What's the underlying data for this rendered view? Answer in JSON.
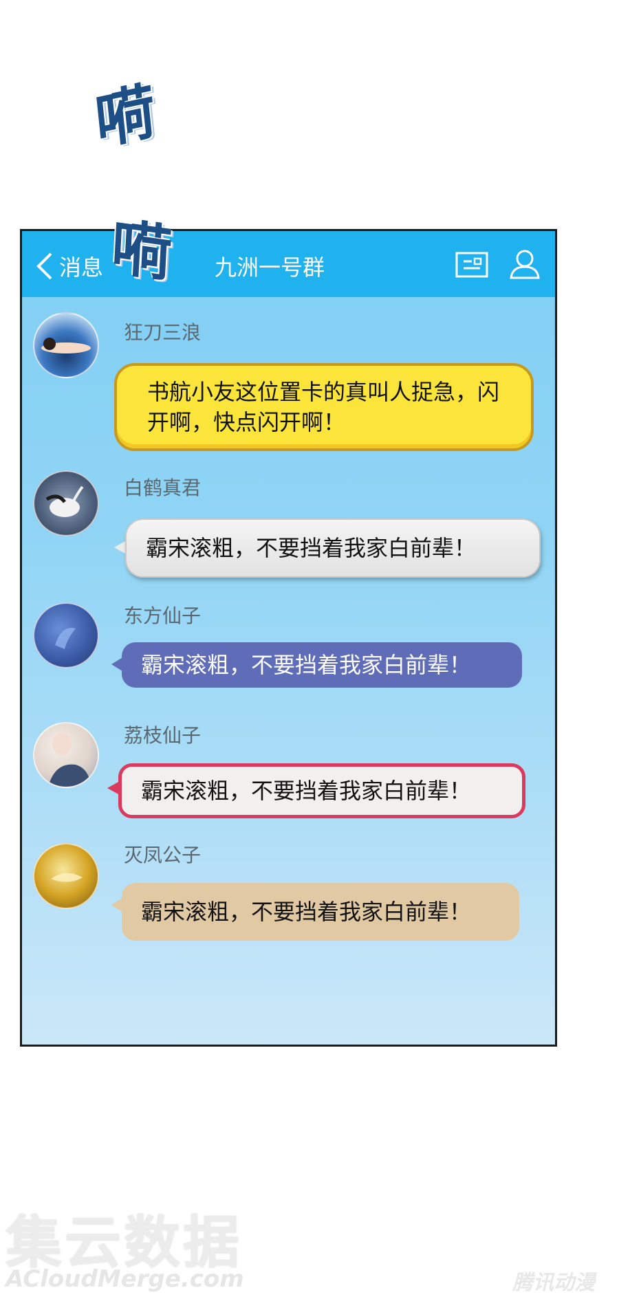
{
  "sfx": [
    "嗬",
    "嗬"
  ],
  "header": {
    "back_label": "消息",
    "title": "九洲一号群"
  },
  "messages": [
    {
      "sender": "狂刀三浪",
      "text": "书航小友这位置卡的真叫人捉急，闪开啊，快点闪开啊！"
    },
    {
      "sender": "白鹤真君",
      "text": "霸宋滚粗，不要挡着我家白前辈！"
    },
    {
      "sender": "东方仙子",
      "text": "霸宋滚粗，不要挡着我家白前辈！"
    },
    {
      "sender": "荔枝仙子",
      "text": "霸宋滚粗，不要挡着我家白前辈！"
    },
    {
      "sender": "灭凤公子",
      "text": "霸宋滚粗，不要挡着我家白前辈！"
    }
  ],
  "watermark": {
    "cn": "集云数据",
    "en": "ACloudMerge.com",
    "logo": "腾讯动漫"
  },
  "colors": {
    "topbar": "#1fb2ee",
    "bubble_yellow": "#fbe53b",
    "bubble_purple": "#5f6db8",
    "bubble_pink_border": "#d93a5e",
    "bubble_tan": "#e1c9a3"
  }
}
